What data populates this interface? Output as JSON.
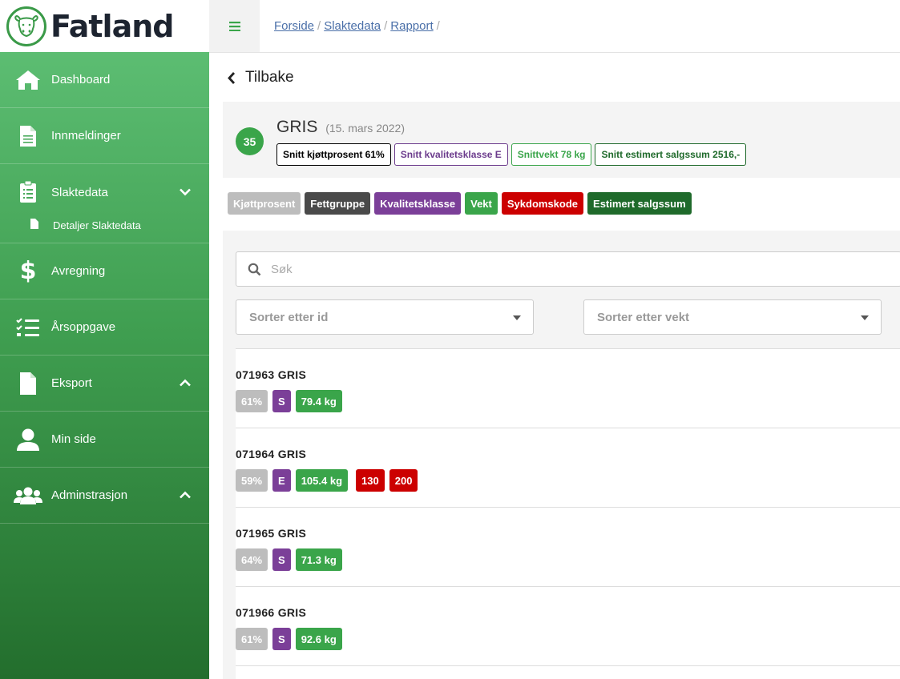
{
  "brand": {
    "name": "Fatland",
    "color": "#3a9a48"
  },
  "breadcrumb": [
    {
      "label": "Forside"
    },
    {
      "label": "Slaktedata"
    },
    {
      "label": "Rapport"
    }
  ],
  "sidebar": {
    "items": [
      {
        "label": "Dashboard",
        "icon": "home-icon"
      },
      {
        "label": "Innmeldinger",
        "icon": "document-icon"
      },
      {
        "label": "Slaktedata",
        "icon": "clipboard-list-icon",
        "expanded": true,
        "sub": [
          {
            "label": "Detaljer Slaktedata",
            "icon": "file-icon"
          }
        ]
      },
      {
        "label": "Avregning",
        "icon": "dollar-icon"
      },
      {
        "label": "Årsoppgave",
        "icon": "checklist-icon"
      },
      {
        "label": "Eksport",
        "icon": "file-icon",
        "expanded": false
      },
      {
        "label": "Min side",
        "icon": "user-icon"
      },
      {
        "label": "Adminstrasjon",
        "icon": "users-icon",
        "expanded": false
      }
    ]
  },
  "back": {
    "label": "Tilbake"
  },
  "summary": {
    "count": "35",
    "animal": "GRIS",
    "date": "(15. mars 2022)",
    "badges": [
      {
        "label": "Snitt kjøttprosent 61%",
        "color": "#000000"
      },
      {
        "label": "Snitt kvalitetsklasse E",
        "color": "#6b3b8c"
      },
      {
        "label": "Snittvekt 78 kg",
        "color": "#3aa54a"
      },
      {
        "label": "Snitt estimert salgssum 2516,-",
        "color": "#1f6a2b"
      }
    ]
  },
  "legend": [
    {
      "label": "Kjøttprosent",
      "color": "#bdbdbd"
    },
    {
      "label": "Fettgruppe",
      "color": "#4a4a4a"
    },
    {
      "label": "Kvalitetsklasse",
      "color": "#7b3f98"
    },
    {
      "label": "Vekt",
      "color": "#3aa54a"
    },
    {
      "label": "Sykdomskode",
      "color": "#cc0000"
    },
    {
      "label": "Estimert salgssum",
      "color": "#1f6a2b"
    }
  ],
  "search": {
    "placeholder": "Søk"
  },
  "sort": {
    "by_id": "Sorter etter id",
    "by_weight": "Sorter etter vekt"
  },
  "rows": [
    {
      "id": "071963 GRIS",
      "pct": "61%",
      "class": "S",
      "weight": "79.4 kg",
      "codes": []
    },
    {
      "id": "071964 GRIS",
      "pct": "59%",
      "class": "E",
      "weight": "105.4 kg",
      "codes": [
        "130",
        "200"
      ]
    },
    {
      "id": "071965 GRIS",
      "pct": "64%",
      "class": "S",
      "weight": "71.3 kg",
      "codes": []
    },
    {
      "id": "071966 GRIS",
      "pct": "61%",
      "class": "S",
      "weight": "92.6 kg",
      "codes": []
    }
  ]
}
